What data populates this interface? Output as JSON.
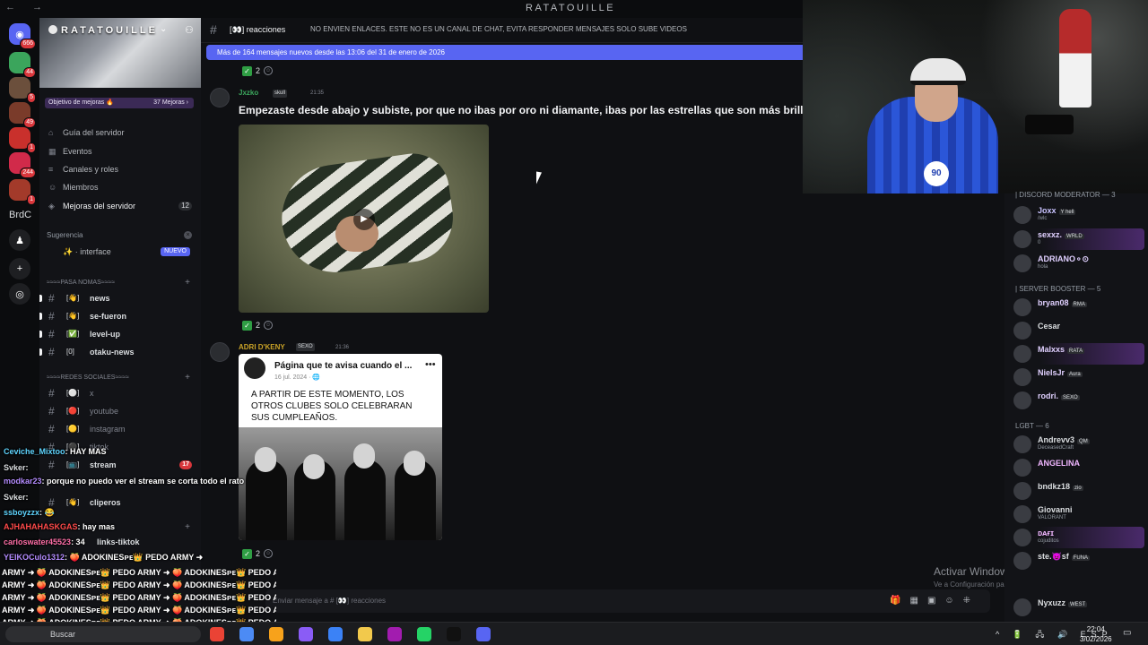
{
  "window": {
    "title": "RATATOUILLE",
    "nav": "← →"
  },
  "rail": {
    "servers": [
      {
        "icon": "discord-icon",
        "color": "#5865f2",
        "badge": "666"
      },
      {
        "icon": "server-icon",
        "color": "#3ba55c",
        "badge": "44"
      },
      {
        "icon": "server-icon",
        "color": "#6b4f3c",
        "badge": "5"
      },
      {
        "icon": "server-icon",
        "color": "#7a3b2a",
        "badge": "49"
      },
      {
        "icon": "server-icon",
        "color": "#c9302c",
        "badge": "1"
      },
      {
        "icon": "server-icon",
        "color": "#d12a4a",
        "badge": "244"
      },
      {
        "icon": "server-icon",
        "color": "#a33a2a",
        "badge": "1"
      }
    ],
    "brdc": "BrdC"
  },
  "sidebar": {
    "guild_name": "RATATOUILLE",
    "goal_label": "Objetivo de mejoras 🔥",
    "goal_count": "37 Mejoras ›",
    "items": [
      {
        "icon": "⌂",
        "label": "Guía del servidor"
      },
      {
        "icon": "▦",
        "label": "Eventos"
      },
      {
        "icon": "≡",
        "label": "Canales y roles"
      },
      {
        "icon": "☺",
        "label": "Miembros"
      },
      {
        "icon": "◈",
        "label": "Mejoras del servidor",
        "count": "12"
      }
    ],
    "suggestion_label": "Sugerencia",
    "suggestion_item": "✨ · interface",
    "suggestion_badge": "NUEVO",
    "cat1": "≈≈≈≈PASA NOMAS≈≈≈≈",
    "cat2": "≈≈≈≈REDES SOCIALES≈≈≈≈",
    "channels1": [
      {
        "emo": "[👋]",
        "name": "news"
      },
      {
        "emo": "[👋]",
        "name": "se-fueron"
      },
      {
        "emo": "[✅]",
        "name": "level-up"
      },
      {
        "emo": "[0]",
        "name": "otaku-news"
      }
    ],
    "channels2": [
      {
        "emo": "[⚪]",
        "name": "x",
        "dim": true
      },
      {
        "emo": "[🔴]",
        "name": "youtube",
        "dim": true
      },
      {
        "emo": "[🟡]",
        "name": "instagram",
        "dim": true
      },
      {
        "emo": "[⚫]",
        "name": "tiktok",
        "dim": true
      },
      {
        "emo": "[📺]",
        "name": "stream",
        "count": "17"
      },
      {
        "emo": "[👋]",
        "name": "cliperos"
      }
    ],
    "links_channel": "links-tiktok"
  },
  "channel": {
    "name": "reacciones",
    "emoji": "[👀]",
    "topic": "NO ENVIEN ENLACES. ESTE NO ES UN CANAL DE CHAT, EVITA RESPONDER MENSAJES SOLO SUBE VIDEOS",
    "new_messages": "Más de 164 mensajes nuevos desde las 13:06 del 31 de enero de 2026"
  },
  "messages": [
    {
      "author": "Jxzko",
      "author_color": "#3ba55c",
      "tag": "skull",
      "time": "21:35",
      "text": "Empezaste desde abajo y subiste, por que no ibas por oro ni diamante, ibas por las estrellas que son más brillantes",
      "reaction": "2"
    },
    {
      "author": "ADRI D'KENY",
      "author_color": "#c9a227",
      "tag": "SEXO",
      "time": "21:36",
      "reaction": "2",
      "post": {
        "title": "Página que te avisa cuando el ...",
        "date": "16 jul. 2024 · 🌐",
        "body": "A PARTIR DE ESTE MOMENTO, LOS OTROS CLUBES SOLO CELEBRARAN SUS CUMPLEAÑOS."
      }
    }
  ],
  "top_reaction": "2",
  "composer": {
    "placeholder": "Enviar mensaje a # [👀] reacciones"
  },
  "windows_watermark": {
    "line1": "Activar Windows",
    "line2": "Ve a Configuración para activar Windows."
  },
  "webcam": {
    "logo": "90"
  },
  "members": {
    "cat_mod": "| DISCORD MODERATOR — 3",
    "mods": [
      {
        "name": "Joxx",
        "tag": "Y hell",
        "sub": "/wlc",
        "color": "#c9c3ff"
      },
      {
        "name": "sexxz.",
        "tag": "WRLD",
        "sub": "0",
        "color": "#e0d0ff",
        "hl": true
      },
      {
        "name": "ADRIANO⚬⊙",
        "tag": "",
        "sub": "hola",
        "color": "#e0d0ff"
      }
    ],
    "cat_boost": "| SERVER BOOSTER — 5",
    "boosters": [
      {
        "name": "bryan08",
        "tag": "RMA",
        "sub": "",
        "color": "#e0d0ff"
      },
      {
        "name": "Cesar",
        "tag": "",
        "sub": "",
        "color": "#dbdee1"
      },
      {
        "name": "Malxxs",
        "tag": "RATA",
        "sub": "",
        "color": "#e0d0ff",
        "hl": true
      },
      {
        "name": "NielsJr",
        "tag": "Aura",
        "sub": "",
        "color": "#e0d0ff"
      },
      {
        "name": "rodri.",
        "tag": "SEXO",
        "sub": "",
        "color": "#e0d0ff"
      }
    ],
    "cat_lgbt": "LGBT — 6",
    "lgbt": [
      {
        "name": "Andrevv3",
        "tag": "QM",
        "sub": "DeceasedCraft",
        "color": "#dbdee1"
      },
      {
        "name": "ANGELINA",
        "tag": "",
        "sub": "",
        "color": "#f0b6ff"
      },
      {
        "name": "bndkz18",
        "tag": "zio",
        "sub": "",
        "color": "#dbdee1"
      },
      {
        "name": "Giovanni",
        "tag": "",
        "sub": "VALORANT",
        "color": "#dbdee1"
      },
      {
        "name": "ᴅᴀғɪ",
        "tag": "",
        "sub": "cojuditos",
        "color": "#f0b6ff",
        "hl": true
      },
      {
        "name": "ste.😈sf",
        "tag": "FUNA",
        "sub": "",
        "color": "#dbdee1"
      }
    ],
    "last": {
      "name": "Nyxuzz",
      "tag": "WEST"
    }
  },
  "stream_chat": [
    {
      "user": "Ceviche_Mixtoo",
      "user_color": "#5fd5ff",
      "text": ": HAY MAS"
    },
    {
      "user": "Svker",
      "user_color": "#dbdee1",
      "text": ": "
    },
    {
      "user": "modkar23",
      "user_color": "#b48cff",
      "text": ": porque no puedo ver el stream se corta todo el rato"
    },
    {
      "user": "Svker",
      "user_color": "#dbdee1",
      "text": ": "
    },
    {
      "user": "ssboyzzx",
      "user_color": "#5fd5ff",
      "text": ": 😂"
    },
    {
      "user": "AJHAHAHASKGAS",
      "user_color": "#ff4a4a",
      "text": ": hay mas"
    },
    {
      "user": "carloswater45523",
      "user_color": "#ff6fa8",
      "text": ": 34"
    },
    {
      "user": "YEIKOCulo1312",
      "user_color": "#b48cff",
      "text": ": 🍑 ADOKINESᴘᴇ👑 PEDO ARMY ➜"
    }
  ],
  "spam_line": "ARMY ➜ 🍑 ADOKINESᴘᴇ👑 PEDO ARMY ➜ 🍑 ADOKINESᴘᴇ👑 PEDO ARMY ➜ 🍑 ADOKINESᴘᴇ👑 PEDO ARMY",
  "taskbar": {
    "search": "Buscar",
    "apps": [
      "#ea4335",
      "#4c8bf5",
      "#f7a21b",
      "#8a5cf6",
      "#3b82f6",
      "#f2c94c",
      "#a21caf",
      "#25d366",
      "#111111",
      "#5865f2"
    ],
    "tray": "^ 🔋 🖧 🔊 ESP",
    "time": "22:04",
    "date": "3/02/2026"
  }
}
